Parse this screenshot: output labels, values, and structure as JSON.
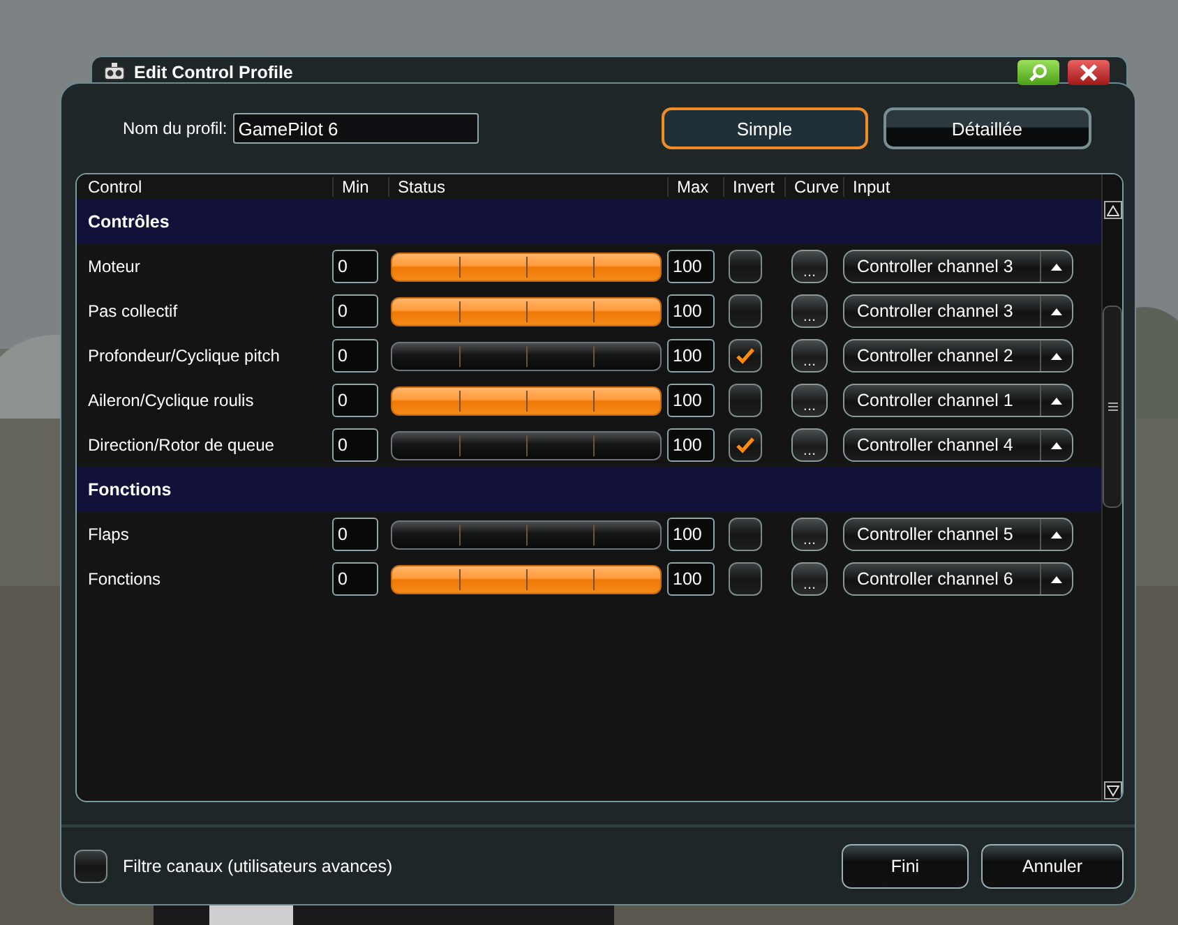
{
  "window": {
    "title": "Edit Control Profile"
  },
  "profile": {
    "label": "Nom du profil:",
    "value": "GamePilot 6"
  },
  "modes": [
    {
      "label": "Simple",
      "selected": true
    },
    {
      "label": "Détaillée",
      "selected": false
    }
  ],
  "table": {
    "columns": [
      "Control",
      "Min",
      "Status",
      "Max",
      "Invert",
      "Curve",
      "Input"
    ],
    "groups": [
      {
        "title": "Contrôles",
        "rows": [
          {
            "name": "Moteur",
            "min": "0",
            "active": true,
            "max": "100",
            "invert": false,
            "curve": "...",
            "input": "Controller channel 3"
          },
          {
            "name": "Pas collectif",
            "min": "0",
            "active": true,
            "max": "100",
            "invert": false,
            "curve": "...",
            "input": "Controller channel 3"
          },
          {
            "name": "Profondeur/Cyclique pitch",
            "min": "0",
            "active": false,
            "max": "100",
            "invert": true,
            "curve": "...",
            "input": "Controller channel 2"
          },
          {
            "name": "Aileron/Cyclique roulis",
            "min": "0",
            "active": true,
            "max": "100",
            "invert": false,
            "curve": "...",
            "input": "Controller channel 1"
          },
          {
            "name": "Direction/Rotor de queue",
            "min": "0",
            "active": false,
            "max": "100",
            "invert": true,
            "curve": "...",
            "input": "Controller channel 4"
          }
        ]
      },
      {
        "title": "Fonctions",
        "rows": [
          {
            "name": "Flaps",
            "min": "0",
            "active": false,
            "max": "100",
            "invert": false,
            "curve": "...",
            "input": "Controller channel 5"
          },
          {
            "name": "Fonctions",
            "min": "0",
            "active": true,
            "max": "100",
            "invert": false,
            "curve": "...",
            "input": "Controller channel 6"
          }
        ]
      }
    ]
  },
  "filter": {
    "label": "Filtre canaux (utilisateurs avances)",
    "checked": false
  },
  "buttons": [
    "Fini",
    "Annuler"
  ]
}
